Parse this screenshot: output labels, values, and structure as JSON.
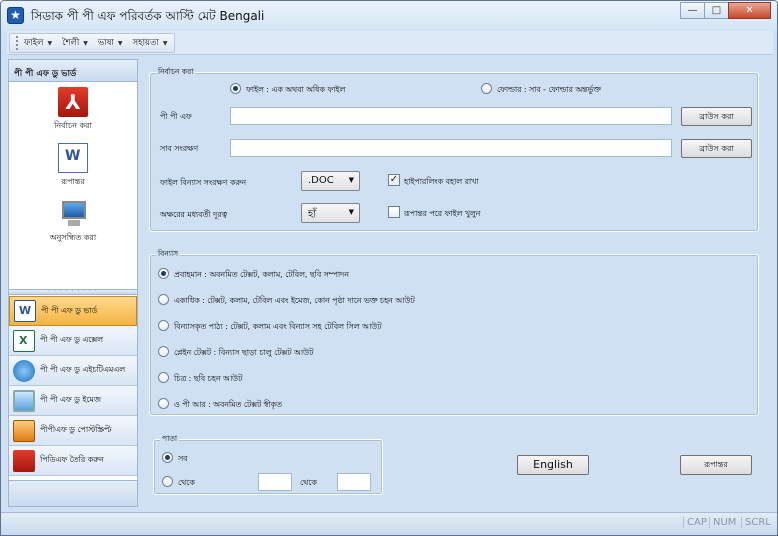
{
  "window": {
    "title": "সিডাক পী পী এফ পরিবর্তক আস্টি মেট Bengali",
    "app_icon": "star-icon",
    "minimize": "—",
    "maximize": "□",
    "close": "✕"
  },
  "menubar": {
    "items": [
      "ফাইল",
      "শৈলী",
      "ভাষা",
      "সহায়তা"
    ]
  },
  "sidebar": {
    "header": "পী পী এফ ডু ভার্ড",
    "tools": [
      {
        "label": "নির্বাচন করা",
        "icon": "pdf-icon"
      },
      {
        "label": "রূপান্তর",
        "icon": "word-document-icon"
      },
      {
        "label": "অনুসন্ধিত করা",
        "icon": "computer-icon"
      }
    ],
    "nav": [
      {
        "label": "পী পী এফ ডু ভার্ড",
        "icon": "word-icon",
        "active": true
      },
      {
        "label": "পী পী এফ ডু এক্সেল",
        "icon": "excel-icon",
        "active": false
      },
      {
        "label": "পী পী এফ ডু এইচটিএমএল",
        "icon": "html-icon",
        "active": false
      },
      {
        "label": "পী পী এফ ডু ইমেজ",
        "icon": "image-icon",
        "active": false
      },
      {
        "label": "পীপীএফ ডু পোস্টস্ক্রিপ্ট",
        "icon": "postscript-icon",
        "active": false
      },
      {
        "label": "পিডিএফ তৈরি করুন",
        "icon": "pdf-create-icon",
        "active": false
      }
    ]
  },
  "select_group": {
    "title": "নির্বাচন করা",
    "radio_file": "ফাইল :  এক অথবা অধিক ফাইল",
    "radio_folder": "ফোল্ডার :  সাব - ফোল্ডার অন্তর্ভুক্ত",
    "pdf_label": "পী পী এফ",
    "pdf_value": "",
    "save_label": "সাব সংরক্ষণ",
    "save_value": "",
    "browse1": "ব্রাউস করা",
    "browse2": "ব্রাউস করা",
    "format_label": "ফাইল বিন্যাস সংরক্ষণ করুন",
    "format_value": ".DOC",
    "keep_layout_label": "হাইপারলিংক বহাল রাখা",
    "keep_layout_checked": true,
    "after_label": "অক্ষরের মধ্যবর্তী দূরত্ব",
    "after_value": "হাঁ",
    "open_after_label": "রূপান্তর পরে ফাইল খুলুন",
    "open_after_checked": false
  },
  "layout_group": {
    "title": "বিন্যাস",
    "options": [
      {
        "label": "প্রবাহমান :  অবনমিত টেক্সট, কলাম, টেবিল, ছবি সম্পাদন",
        "selected": true
      },
      {
        "label": "একাধিক :  টেক্সট, কলাম, টেবিল এবং ইমেজ, কোন পৃষ্ঠা দানে ভক্ত চহন আউট",
        "selected": false
      },
      {
        "label": "বিন্যাসকৃত পাঠ্য  :  টেক্সট, কলাম এবং বিন্যাস সহ টেবিল সিল আউট",
        "selected": false
      },
      {
        "label": "প্লেইন টেক্সট :  বিন্যাস ছাড়া চালু টেক্সট আউট",
        "selected": false
      },
      {
        "label": "চিত্র :  ছবি চহন আউট",
        "selected": false
      },
      {
        "label": "ও পী আর :  অবনমিত টেক্সট স্বীকৃত",
        "selected": false
      }
    ]
  },
  "pages_group": {
    "title": "পাতা",
    "all": "সব",
    "from": "থেকে",
    "to": "থেকে",
    "from_value": "",
    "to_value": ""
  },
  "language_button": "English",
  "convert_button": "রূপান্তর",
  "status": [
    "CAP",
    "NUM",
    "SCRL"
  ]
}
